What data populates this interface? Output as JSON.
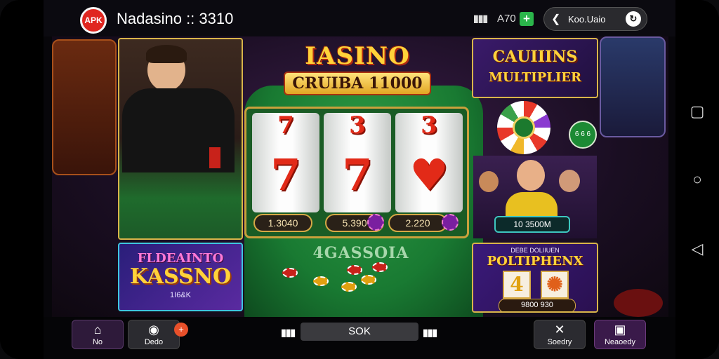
{
  "status": {
    "apk_badge": "APK",
    "app_title": "Nadasino :: 3310",
    "signal_glyph": "▮▮▮",
    "signal_value": "A70",
    "plus": "+",
    "account": {
      "lead_icon": "chevron-left-icon",
      "label": "Koo.Uaio",
      "trail_icon": "refresh-icon"
    }
  },
  "hero": {
    "logo_line1": "IASINO",
    "logo_line2": "CRUIBA 11000",
    "reels": [
      {
        "top": "7",
        "main": "7",
        "amount": "1.3040"
      },
      {
        "top": "3",
        "main": "7",
        "amount": "5.390"
      },
      {
        "top": "3",
        "main": "♥",
        "amount": "2.220"
      }
    ],
    "table_text": "4GASSOIA"
  },
  "promo_left": {
    "line1": "FLDEAINTO",
    "line2": "KASSNO",
    "line3": "1I6&K"
  },
  "multiplier_card": {
    "line1": "CAUIIINS",
    "line2": "MULTIPLIER"
  },
  "round_badge": "6 6 6",
  "win_pill": "10 3500M",
  "bonus_card": {
    "line1": "DEBE DOLIIUEN",
    "line2": "POLTIPHENX",
    "reel_value": "4",
    "reel_symbol": "✺",
    "amount": "9800 930"
  },
  "bottom_nav": {
    "home": {
      "icon": "home-icon",
      "label": "No"
    },
    "media": {
      "icon": "media-icon",
      "label": "Dedo"
    },
    "badge": "+",
    "bars_left": "▮▮▮",
    "center_label": "SOK",
    "bars_right": "▮▮▮",
    "society": {
      "icon": "tools-icon",
      "label": "Soedry"
    },
    "account": {
      "icon": "account-icon",
      "label": "Neaoedy"
    }
  },
  "system_nav": {
    "back": "◁",
    "home": "○",
    "recents": "▢"
  },
  "colors": {
    "accent": "#d9b54a",
    "felt": "#197a32",
    "brand": "#e0261f"
  }
}
